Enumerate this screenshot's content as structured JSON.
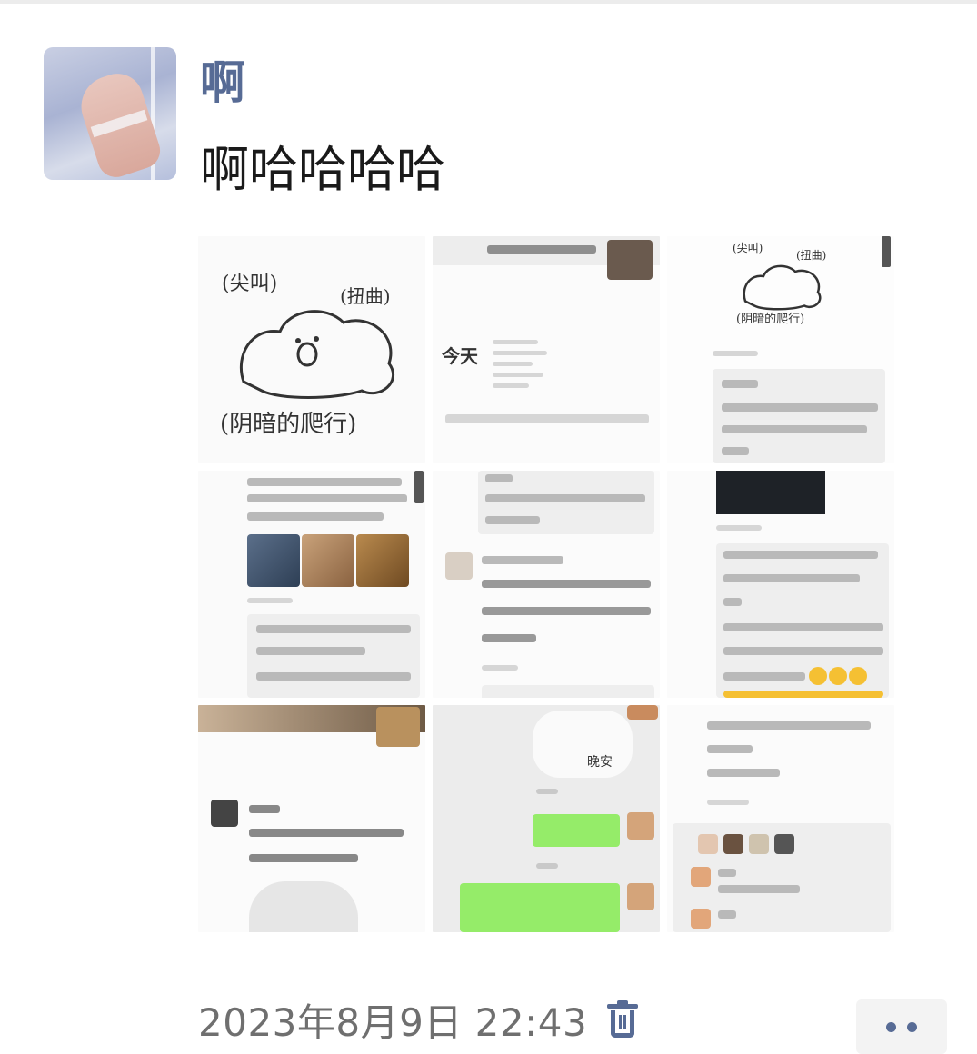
{
  "post": {
    "username": "啊",
    "text": "啊哈哈哈哈",
    "timestamp": "2023年8月9日 22:43"
  },
  "images": [
    {
      "label": "(尖叫)",
      "label2": "(扭曲)",
      "label3": "(阴暗的爬行)"
    },
    {
      "label": "今天"
    },
    {
      "label": "(尖叫)",
      "label2": "(扭曲)",
      "label3": "(阴暗的爬行)"
    },
    {
      "label": ""
    },
    {
      "label": ""
    },
    {
      "label": ""
    },
    {
      "label": ""
    },
    {
      "label": "晚安"
    },
    {
      "label": ""
    }
  ],
  "icons": {
    "delete": "trash-icon",
    "more": "more-dots-icon"
  },
  "colors": {
    "link": "#576b95",
    "bubble_green": "#95ec69"
  }
}
